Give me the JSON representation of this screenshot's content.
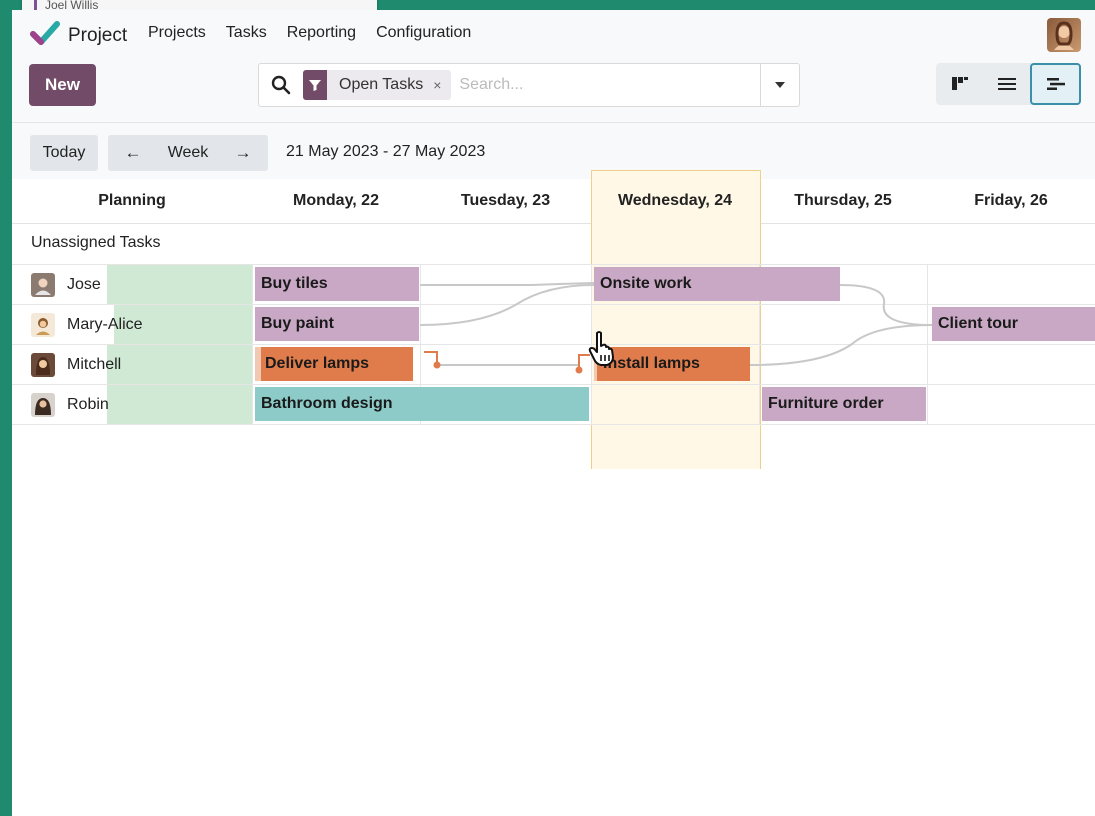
{
  "background_window": {
    "text": "Joel Willis"
  },
  "brand": {
    "name": "Project"
  },
  "menu": [
    "Projects",
    "Tasks",
    "Reporting",
    "Configuration"
  ],
  "toolbar": {
    "new_label": "New"
  },
  "search": {
    "facet_label": "Open Tasks",
    "facet_remove": "×",
    "placeholder": "Search..."
  },
  "controls": {
    "today_label": "Today",
    "prev_icon": "←",
    "scale_label": "Week",
    "next_icon": "→",
    "range_label": "21 May 2023 - 27 May 2023"
  },
  "columns": {
    "planning": "Planning",
    "days": [
      "Monday, 22",
      "Tuesday, 23",
      "Wednesday, 24",
      "Thursday, 25",
      "Friday, 26"
    ],
    "today_index": 2
  },
  "groups": {
    "unassigned": "Unassigned Tasks",
    "rows": [
      "Jose",
      "Mary-Alice",
      "Mitchell",
      "Robin"
    ]
  },
  "tasks": [
    {
      "name": "Buy tiles",
      "assignee": "Jose",
      "color": "#c8a8c4"
    },
    {
      "name": "Onsite work",
      "assignee": "Jose",
      "color": "#c8a8c4"
    },
    {
      "name": "Buy paint",
      "assignee": "Mary-Alice",
      "color": "#c8a8c4"
    },
    {
      "name": "Client tour",
      "assignee": "Mary-Alice",
      "color": "#c8a8c4"
    },
    {
      "name": "Deliver lamps",
      "assignee": "Mitchell",
      "color": "#e07c4b"
    },
    {
      "name": "Install lamps",
      "assignee": "Mitchell",
      "color": "#e07c4b"
    },
    {
      "name": "Bathroom design",
      "assignee": "Robin",
      "color": "#8dcbc9"
    },
    {
      "name": "Furniture order",
      "assignee": "Robin",
      "color": "#c8a8c4"
    }
  ],
  "colors": {
    "brand": "#714b67",
    "background": "#1f8a6e",
    "today_highlight": "#fff8e6"
  }
}
